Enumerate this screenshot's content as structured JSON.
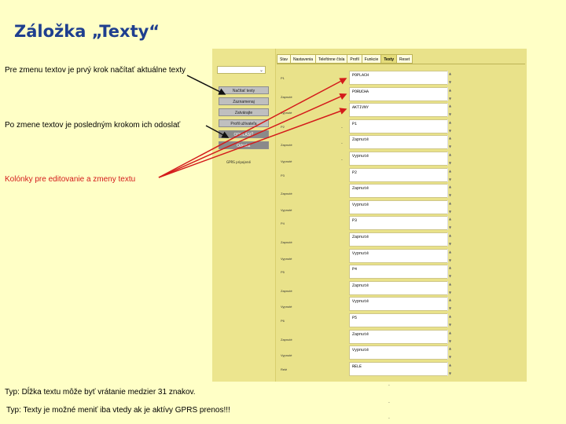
{
  "title": "Záložka „Texty“",
  "notes": {
    "read": "Pre zmenu textov je prvý krok načítať aktuálne texty",
    "send": "Po zmene textov je posledným krokom ich odoslať",
    "columns": "Kolónky pre editovanie a zmeny textu",
    "length": "Typ: Dĺžka textu môže byť vrátanie medzier 31 znakov.",
    "gprs": "Typ: Texty je možné meniť iba vtedy ak je aktívy GPRS prenos!!!"
  },
  "sidebar": {
    "select_value": "",
    "buttons": [
      {
        "label": "Načítať texty",
        "dark": false
      },
      {
        "label": "Zaznamenaj",
        "dark": false
      },
      {
        "label": "Zatvárajte",
        "dark": false
      },
      {
        "label": "Profil užívateľa",
        "dark": false
      },
      {
        "label": "ODHLÁSIŤ",
        "dark": true
      },
      {
        "label": "Odoslať",
        "dark": true
      }
    ],
    "gprs_label": "GPRS pripojené"
  },
  "tabs": [
    {
      "label": "Stav",
      "active": false
    },
    {
      "label": "Nastavenia",
      "active": false
    },
    {
      "label": "Telefónne čísla",
      "active": false
    },
    {
      "label": "Profil",
      "active": false
    },
    {
      "label": "Funkcie",
      "active": false
    },
    {
      "label": "Texty",
      "active": true
    },
    {
      "label": "Reset",
      "active": false
    }
  ],
  "rows": [
    {
      "label": "P1",
      "value": "POPLACH"
    },
    {
      "label": "Zapnuté",
      "value": "PORUCHA"
    },
    {
      "label": "Vypnuté",
      "value": "AKTIVNY"
    },
    {
      "label": "P2",
      "value": "P1"
    },
    {
      "label": "Zapnuté",
      "value": "Zapnuté"
    },
    {
      "label": "Vypnuté",
      "value": "Vypnuté"
    },
    {
      "label": "P3",
      "value": "P2"
    },
    {
      "label": "Zapnuté",
      "value": "Zapnuté"
    },
    {
      "label": "Vypnuté",
      "value": "Vypnuté"
    },
    {
      "label": "P4",
      "value": "P3"
    },
    {
      "label": "Zapnuté",
      "value": "Zapnuté"
    },
    {
      "label": "Vypnuté",
      "value": "Vypnuté"
    },
    {
      "label": "P5",
      "value": "P4"
    },
    {
      "label": "Zapnuté",
      "value": "Zapnuté"
    },
    {
      "label": "Vypnuté",
      "value": "Vypnuté"
    },
    {
      "label": "P6",
      "value": "P5"
    },
    {
      "label": "Zapnuté",
      "value": "Zapnuté"
    },
    {
      "label": "Vypnuté",
      "value": "Vypnuté"
    },
    {
      "label": "Relé",
      "value": "RELE"
    }
  ],
  "colors": {
    "background": "#ffffc6",
    "title": "#1f3f8f",
    "accent_red": "#d41b1b",
    "panel": "#e9e28a"
  }
}
